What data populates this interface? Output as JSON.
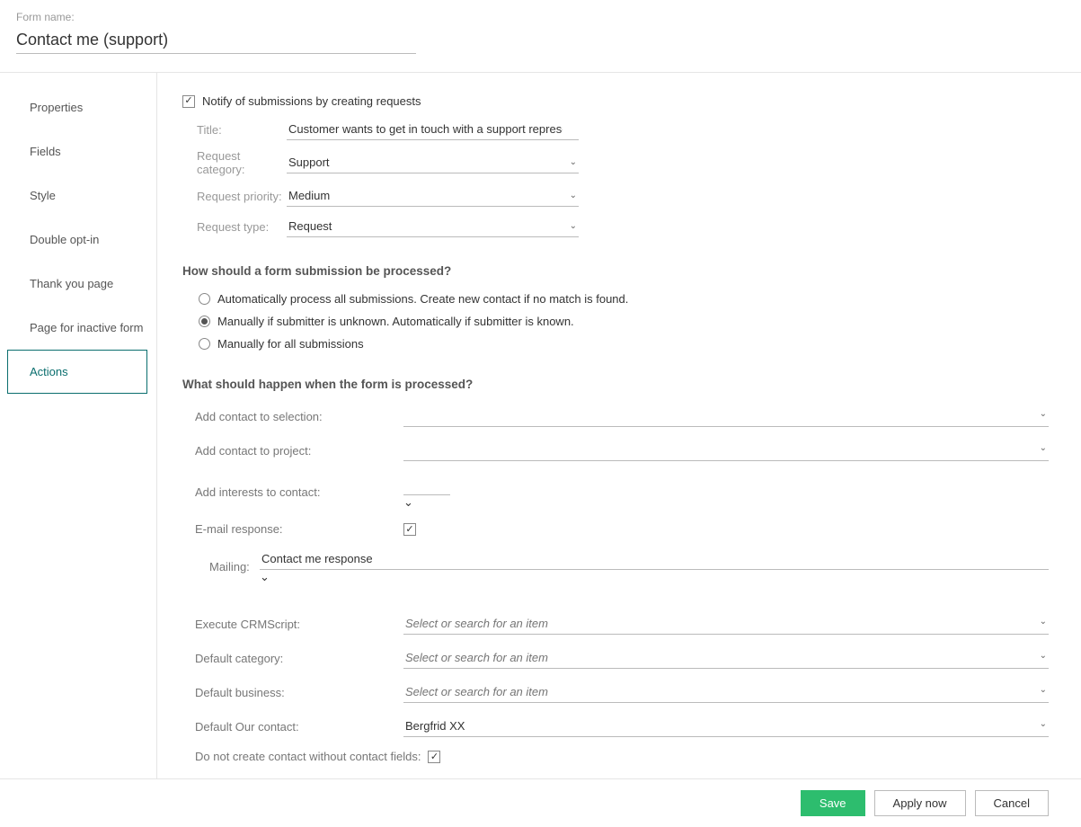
{
  "header": {
    "form_name_label": "Form name:",
    "form_name_value": "Contact me (support)"
  },
  "sidebar": {
    "items": [
      {
        "label": "Properties"
      },
      {
        "label": "Fields"
      },
      {
        "label": "Style"
      },
      {
        "label": "Double opt-in"
      },
      {
        "label": "Thank you page"
      },
      {
        "label": "Page for inactive form"
      },
      {
        "label": "Actions"
      }
    ],
    "active_index": 6
  },
  "notify": {
    "checkbox_label": "Notify of submissions by creating requests",
    "title_label": "Title:",
    "title_value": "Customer wants to get in touch with a support representative",
    "category_label": "Request category:",
    "category_value": "Support",
    "priority_label": "Request priority:",
    "priority_value": "Medium",
    "type_label": "Request type:",
    "type_value": "Request"
  },
  "processing": {
    "heading": "How should a form submission be processed?",
    "options": [
      "Automatically process all submissions. Create new contact if no match is found.",
      "Manually if submitter is unknown. Automatically if submitter is known.",
      "Manually for all submissions"
    ],
    "selected_index": 1
  },
  "processed_actions": {
    "heading": "What should happen when the form is processed?",
    "add_to_selection_label": "Add contact to selection:",
    "add_to_selection_value": "",
    "add_to_project_label": "Add contact to project:",
    "add_to_project_value": "",
    "add_interests_label": "Add interests to contact:",
    "email_response_label": "E-mail response:",
    "mailing_label": "Mailing:",
    "mailing_value": "Contact me response",
    "execute_crmscript_label": "Execute CRMScript:",
    "execute_crmscript_placeholder": "Select or search for an item",
    "default_category_label": "Default category:",
    "default_category_placeholder": "Select or search for an item",
    "default_business_label": "Default business:",
    "default_business_placeholder": "Select or search for an item",
    "default_our_contact_label": "Default Our contact:",
    "default_our_contact_value": "Bergfrid XX",
    "no_contact_label": "Do not create contact without contact fields:"
  },
  "footer": {
    "save": "Save",
    "apply": "Apply now",
    "cancel": "Cancel"
  }
}
